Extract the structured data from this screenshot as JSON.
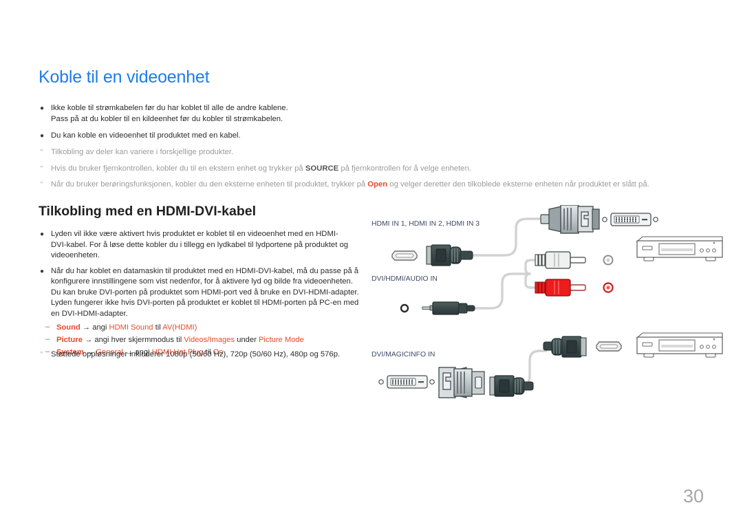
{
  "page": {
    "title": "Koble til en videoenhet",
    "number": "30",
    "accent_color": "#e8492b",
    "title_color": "#1d7ced"
  },
  "top_notes": [
    {
      "marker": "bullet",
      "lines": [
        "Ikke koble til strømkabelen før du har koblet til alle de andre kablene.",
        "Pass på at du kobler til en kildeenhet før du kobler til strømkabelen."
      ]
    },
    {
      "marker": "bullet",
      "lines": [
        "Du kan koble en videoenhet til produktet med en kabel."
      ]
    },
    {
      "marker": "quote",
      "lines": [
        "Tilkobling av deler kan variere i forskjellige produkter."
      ]
    },
    {
      "marker": "quote",
      "segments": [
        {
          "text": "Hvis du bruker fjernkontrollen, kobler du til en ekstern enhet og trykker på ",
          "style": "muted"
        },
        {
          "text": "SOURCE",
          "style": "muted-bold"
        },
        {
          "text": " på fjernkontrollen for å velge enheten.",
          "style": "muted"
        }
      ]
    },
    {
      "marker": "quote",
      "segments": [
        {
          "text": "Når du bruker berøringsfunksjonen, kobler du den eksterne enheten til produktet, trykker på ",
          "style": "muted"
        },
        {
          "text": "Open",
          "style": "accent"
        },
        {
          "text": " og velger deretter den tilkoblede eksterne enheten når produktet er slått på.",
          "style": "muted"
        }
      ]
    }
  ],
  "section": {
    "heading": "Tilkobling med en HDMI-DVI-kabel",
    "bullets": [
      {
        "lines": [
          "Lyden vil ikke være aktivert hvis produktet er koblet til en videoenhet med en HDMI-",
          "DVI-kabel. For å løse dette kobler du i tillegg en lydkabel til lydportene på produktet og",
          "videoenheten."
        ]
      },
      {
        "lines": [
          "Når du har koblet en datamaskin til produktet med en HDMI-DVI-kabel, må du passe på å",
          "konfigurere innstillingene som vist nedenfor, for å aktivere lyd og bilde fra videoenheten.",
          "Du kan bruke DVI-porten på produktet som HDMI-port ved å bruke en DVI-HDMI-adapter.",
          "Lyden fungerer ikke hvis DVI-porten på produktet er koblet til HDMI-porten på PC-en med",
          "en DVI-HDMI-adapter."
        ]
      }
    ],
    "sub_items": [
      [
        {
          "text": "Sound",
          "style": "accent"
        },
        {
          "text": " → angi ",
          "style": "plain"
        },
        {
          "text": "HDMI Sound",
          "style": "accent"
        },
        {
          "text": " til ",
          "style": "plain"
        },
        {
          "text": "AV(HDMI)",
          "style": "accent"
        }
      ],
      [
        {
          "text": "Picture",
          "style": "accent"
        },
        {
          "text": " → angi hver skjermmodus til ",
          "style": "plain"
        },
        {
          "text": "Videos/Images",
          "style": "accent"
        },
        {
          "text": " under ",
          "style": "plain"
        },
        {
          "text": "Picture Mode",
          "style": "accent"
        }
      ],
      [
        {
          "text": "System",
          "style": "accent"
        },
        {
          "text": " → ",
          "style": "plain"
        },
        {
          "text": "General",
          "style": "accent"
        },
        {
          "text": " → angi ",
          "style": "plain"
        },
        {
          "text": "HDMI Hot Plug",
          "style": "accent"
        },
        {
          "text": " til ",
          "style": "plain"
        },
        {
          "text": "On",
          "style": "accent"
        }
      ]
    ],
    "final_note": "Støttede oppløsninger inkluderer 1080p (50/60 Hz), 720p (50/60 Hz), 480p og 576p."
  },
  "diagram": {
    "labels": [
      "HDMI IN 1, HDMI IN 2, HDMI IN 3",
      "DVI/HDMI/AUDIO IN",
      "DVI/MAGICINFO IN"
    ],
    "label_color": "#3f4a66",
    "cable_color": "#d4d4d4",
    "connector_dark": "#3c4a4c",
    "connector_light": "#c9cfd2",
    "audio_red": "#ee1c1c",
    "audio_white": "#e8e8e8"
  }
}
